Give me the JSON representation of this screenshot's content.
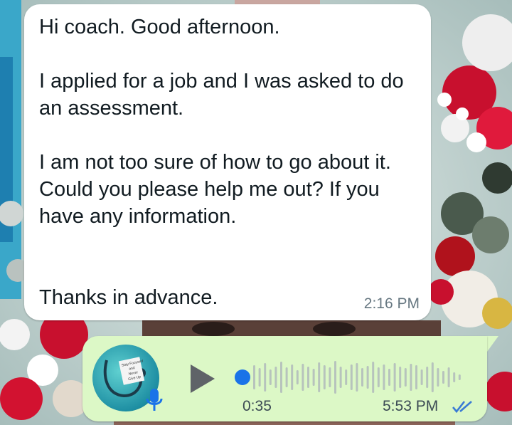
{
  "colors": {
    "incoming_bubble": "#ffffff",
    "outgoing_bubble": "#dcf8c6",
    "read_ticks": "#3a7bd5",
    "seek_dot": "#1a73e8"
  },
  "incoming_message": {
    "text": "Hi coach. Good afternoon.\n\nI applied for a job and I was asked to do an assessment.\n\nI am not too sure of how to go about it. Could you please help me out? If you have any information.\n\n\nThanks in advance.",
    "time": "2:16 PM"
  },
  "voice_message": {
    "avatar_icon": "avatar-stethoscope",
    "avatar_text": [
      "Stay Focused",
      "and",
      "Never",
      "Give Up"
    ],
    "play_icon": "play-icon",
    "mic_icon": "mic-icon",
    "duration": "0:35",
    "time": "5:53 PM",
    "status_icon": "double-check-read-icon",
    "progress": 0
  }
}
